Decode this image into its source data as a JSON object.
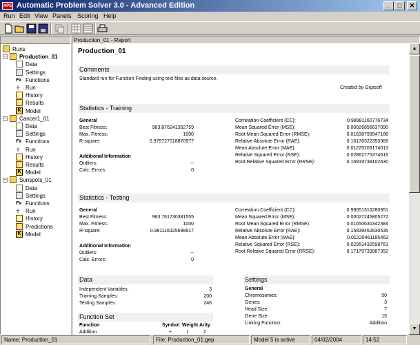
{
  "window": {
    "title": "Automatic Problem Solver 3.0 - Advanced Edition",
    "logo": "APS",
    "controls": {
      "minimize": "_",
      "maximize": "□",
      "close": "✕"
    }
  },
  "menu": [
    "Run",
    "Edit",
    "View",
    "Panels",
    "Scoring",
    "Help"
  ],
  "toolbar": [
    "new-icon",
    "open-icon",
    "save-icon",
    "save-all-icon",
    "copy-icon",
    "grid-icon",
    "table-icon",
    "print-icon"
  ],
  "tree": {
    "root": "Runs",
    "runs": [
      {
        "name": "Production_01",
        "items": [
          "Data",
          "Settings",
          "Functions",
          "Run",
          "History",
          "Results",
          "Model"
        ]
      },
      {
        "name": "Cancer1_01",
        "items": [
          "Data",
          "Settings",
          "Functions",
          "Run",
          "History",
          "Results",
          "Model"
        ]
      },
      {
        "name": "Sunspots_01",
        "items": [
          "Data",
          "Settings",
          "Functions",
          "Run",
          "History",
          "Predictions",
          "Model"
        ]
      }
    ]
  },
  "report": {
    "tab": "Production_01 - Report",
    "title": "Production_01",
    "comments": {
      "heading": "Comments",
      "text": "Standard run for Function Finding using text files as data source.",
      "credit": "Created by Gepsoft"
    },
    "training": {
      "heading": "Statistics - Training",
      "general": "General",
      "left": [
        {
          "label": "Best Fitness:",
          "value": "983.876241352759"
        },
        {
          "label": "Max. Fitness:",
          "value": "1000"
        },
        {
          "label": "R-square:",
          "value": "0.979727018870977"
        }
      ],
      "additional": "Additional Information",
      "extra": [
        {
          "label": "Outliers:",
          "value": "--"
        },
        {
          "label": "Calc. Errors:",
          "value": "0"
        }
      ],
      "right": [
        {
          "label": "Correlation Coefficient (CC):",
          "value": "0.98981160776734"
        },
        {
          "label": "Mean Squared Error (MSE):",
          "value": "0.00026856637090"
        },
        {
          "label": "Root Mean Squared Error (RMSE):",
          "value": "0.01638799947188"
        },
        {
          "label": "Relative Absolute Error (RAE):",
          "value": "0.16176322353366"
        },
        {
          "label": "Mean Absolute Error (MAE):",
          "value": "0.01225203174013"
        },
        {
          "label": "Relative Squared Error (RSE):",
          "value": "0.02862775374616"
        },
        {
          "label": "Root Relative Squared Error (RRSE):",
          "value": "0.16919738102630"
        }
      ]
    },
    "testing": {
      "heading": "Statistics - Testing",
      "general": "General",
      "left": [
        {
          "label": "Best Fitness:",
          "value": "983.761730381555"
        },
        {
          "label": "Max. Fitness:",
          "value": "1000"
        },
        {
          "label": "R-square:",
          "value": "0.981116325698917"
        }
      ],
      "additional": "Additional Information",
      "extra": [
        {
          "label": "Outliers:",
          "value": "--"
        },
        {
          "label": "Calc. Errors:",
          "value": "0"
        }
      ],
      "right": [
        {
          "label": "Correlation Coefficient (CC):",
          "value": "0.99051316280951"
        },
        {
          "label": "Mean Squared Error (MSE):",
          "value": "0.00027245805272"
        },
        {
          "label": "Root Mean Squared Error (RMSE):",
          "value": "0.01650630342384"
        },
        {
          "label": "Relative Absolute Error (RAE):",
          "value": "0.15839462830535"
        },
        {
          "label": "Mean Absolute Error (MAE):",
          "value": "0.01220461185463"
        },
        {
          "label": "Relative Squared Error (RSE):",
          "value": "0.02951432598761"
        },
        {
          "label": "Root Relative Squared Error (RRSE):",
          "value": "0.17179733987352"
        }
      ]
    },
    "data": {
      "heading": "Data",
      "rows": [
        {
          "label": "Independent Variables:",
          "value": "3"
        },
        {
          "label": "Training Samples:",
          "value": "200"
        },
        {
          "label": "Testing Samples:",
          "value": "246"
        }
      ]
    },
    "settings": {
      "heading": "Settings",
      "general": "General",
      "rows": [
        {
          "label": "Chromosomes:",
          "value": "50"
        },
        {
          "label": "Genes:",
          "value": "3"
        },
        {
          "label": "Head Size:",
          "value": "7"
        },
        {
          "label": "Gene Size:",
          "value": "15"
        },
        {
          "label": "Linking Function:",
          "value": "Addition"
        }
      ]
    },
    "function_set": {
      "heading": "Function Set",
      "columns": [
        "Function",
        "Symbol",
        "Weight",
        "Arity"
      ],
      "row": [
        "Addition",
        "+",
        "1",
        "2"
      ]
    }
  },
  "status": {
    "name": "Name: Production_01",
    "file": "File: Production_01.gep",
    "model": "Model 5 is active",
    "date": "04/02/2004",
    "time": "14:52"
  }
}
